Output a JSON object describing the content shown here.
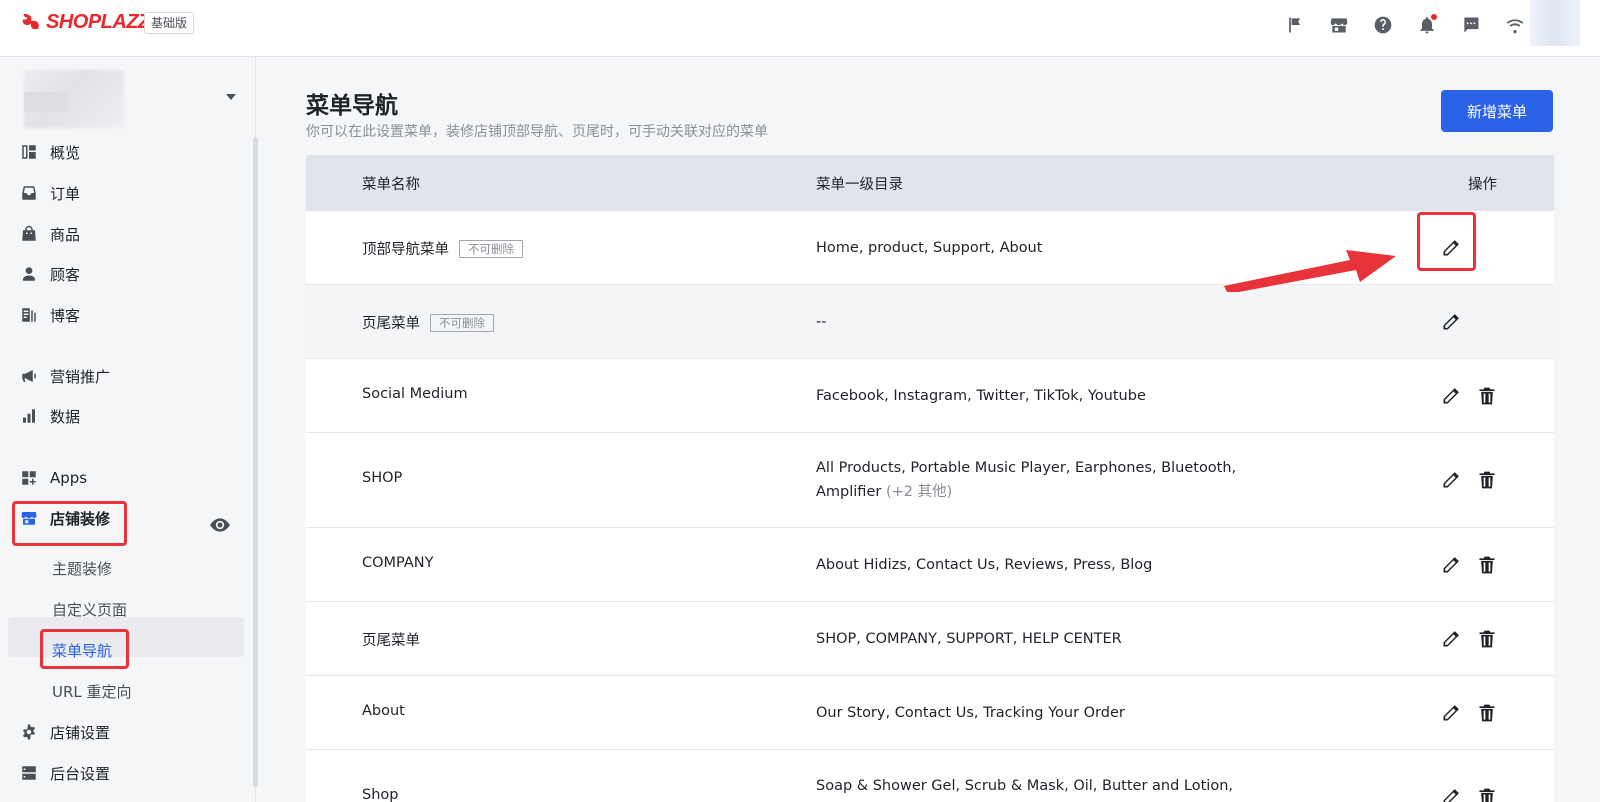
{
  "app": {
    "brand": "SHOPLAZZA",
    "plan_badge": "基础版"
  },
  "topbar_icons": [
    "flag-icon",
    "store-icon",
    "help-icon",
    "bell-icon",
    "chat-icon",
    "wifi-icon"
  ],
  "sidebar": {
    "items": [
      {
        "id": "overview",
        "label": "概览",
        "icon": "dashboard-icon"
      },
      {
        "id": "orders",
        "label": "订单",
        "icon": "inbox-icon"
      },
      {
        "id": "products",
        "label": "商品",
        "icon": "bag-icon"
      },
      {
        "id": "customers",
        "label": "顾客",
        "icon": "person-icon"
      },
      {
        "id": "blog",
        "label": "博客",
        "icon": "blog-icon"
      },
      {
        "id": "marketing",
        "label": "营销推广",
        "icon": "megaphone-icon"
      },
      {
        "id": "analytics",
        "label": "数据",
        "icon": "bar-chart-icon"
      },
      {
        "id": "apps",
        "label": "Apps",
        "icon": "apps-icon"
      },
      {
        "id": "online-store",
        "label": "店铺装修",
        "icon": "storefront-icon"
      },
      {
        "id": "settings",
        "label": "店铺设置",
        "icon": "gear-icon"
      },
      {
        "id": "admin-settings",
        "label": "后台设置",
        "icon": "server-icon"
      }
    ],
    "sub_items": [
      {
        "id": "themes",
        "label": "主题装修"
      },
      {
        "id": "pages",
        "label": "自定义页面"
      },
      {
        "id": "navigation",
        "label": "菜单导航"
      },
      {
        "id": "url-redirect",
        "label": "URL 重定向"
      }
    ]
  },
  "main": {
    "title": "菜单导航",
    "subtitle": "你可以在此设置菜单，装修店铺顶部导航、页尾时，可手动关联对应的菜单",
    "add_button": "新增菜单"
  },
  "table": {
    "headers": {
      "name": "菜单名称",
      "directory": "菜单一级目录",
      "actions": "操作"
    },
    "rows": [
      {
        "name": "顶部导航菜单",
        "tag": "不可删除",
        "directory": "Home, product, Support, About",
        "more": "",
        "deletable": false
      },
      {
        "name": "页尾菜单",
        "tag": "不可删除",
        "directory": "--",
        "more": "",
        "deletable": false
      },
      {
        "name": "Social Medium",
        "tag": "",
        "directory": "Facebook, Instagram, Twitter, TikTok, Youtube",
        "more": "",
        "deletable": true
      },
      {
        "name": "SHOP",
        "tag": "",
        "directory": "All Products, Portable Music Player, Earphones, Bluetooth, Amplifier",
        "more": "(+2 其他)",
        "deletable": true
      },
      {
        "name": "COMPANY",
        "tag": "",
        "directory": "About Hidizs, Contact Us, Reviews, Press, Blog",
        "more": "",
        "deletable": true
      },
      {
        "name": "页尾菜单",
        "tag": "",
        "directory": "SHOP, COMPANY, SUPPORT, HELP CENTER",
        "more": "",
        "deletable": true
      },
      {
        "name": "About",
        "tag": "",
        "directory": "Our Story, Contact Us, Tracking Your Order",
        "more": "",
        "deletable": true
      },
      {
        "name": "Shop",
        "tag": "",
        "directory": "Soap & Shower Gel, Scrub & Mask, Oil, Butter and Lotion,",
        "more": "",
        "deletable": true
      }
    ]
  },
  "colors": {
    "brand_red": "#e8282b",
    "primary": "#2a62e8",
    "annotation_red": "#e8333a"
  }
}
